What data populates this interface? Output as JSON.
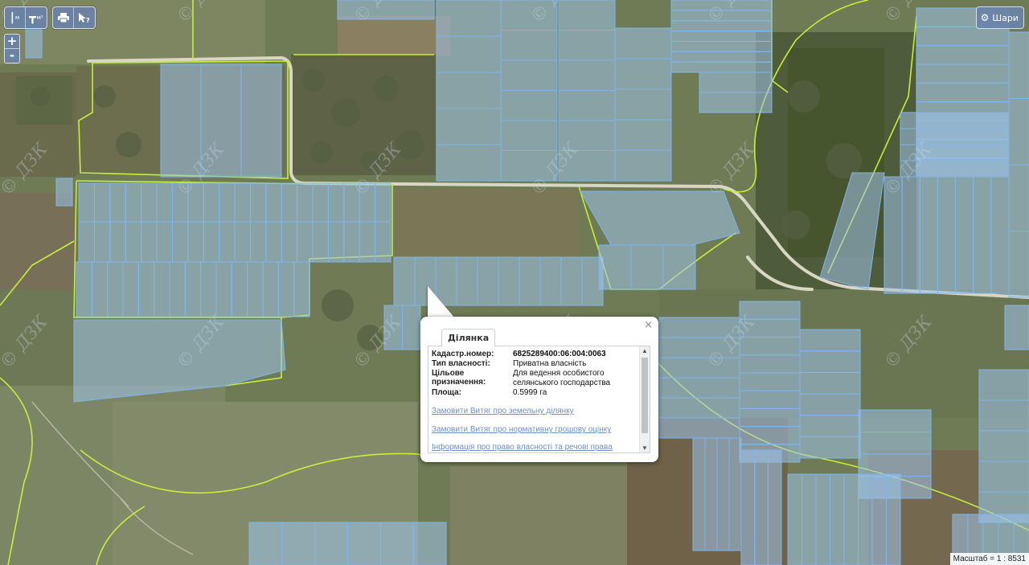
{
  "toolbar": {
    "measure_line_sub": "м",
    "measure_area_sub": "м²"
  },
  "zoom": {
    "in_label": "+",
    "out_label": "-"
  },
  "layers": {
    "label": "Шари"
  },
  "watermark": "© ДЗК",
  "popup": {
    "tab_label": "Ділянка",
    "close_label": "×",
    "fields": [
      {
        "key": "Кадастр.номер:",
        "value": "6825289400:06:004:0063",
        "bold": true
      },
      {
        "key": "Тип власності:",
        "value": "Приватна власність",
        "bold": false
      },
      {
        "key": "Цільове призначення:",
        "value": "Для ведення особистого селянського господарства",
        "bold": false
      },
      {
        "key": "Площа:",
        "value": "0.5999 га",
        "bold": false
      }
    ],
    "links": [
      "Замовити Витяг про земельну ділянку",
      "Замовити Витяг про нормативну грошову оцінку",
      "Інформація про право власності та речові права"
    ]
  },
  "scale": {
    "text": "Масштаб = 1 : 8531"
  },
  "colors": {
    "parcel_fill": "#9ec3ea",
    "parcel_stroke": "#7eb6ec",
    "boundary": "#c6ee3a",
    "road": "#d9d6c4",
    "control_bg": "#6a82a8"
  }
}
